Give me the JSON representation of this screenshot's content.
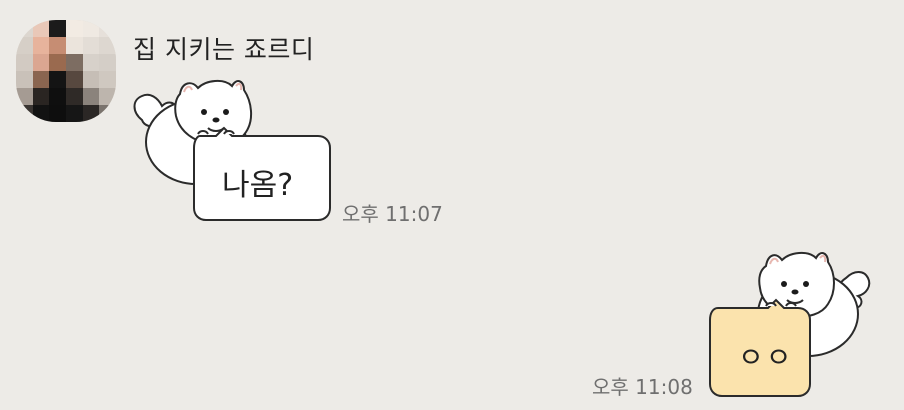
{
  "chat": {
    "sender": {
      "name": "집 지키는 죠르디"
    },
    "messages": [
      {
        "direction": "incoming",
        "sticker_text": "나옴?",
        "time": "오후 11:07",
        "bubble_color": "#ffffff"
      },
      {
        "direction": "outgoing",
        "sticker_text": "ㅇㅇ",
        "time": "오후 11:08",
        "bubble_color": "#fbe3ad"
      }
    ]
  },
  "colors": {
    "background": "#edebe7",
    "outline": "#2b2b2b",
    "timestamp": "#6f6f6f"
  },
  "icons": {
    "avatar": "pixelated-profile-photo",
    "sticker": "white-fluffy-dog-sticker"
  }
}
